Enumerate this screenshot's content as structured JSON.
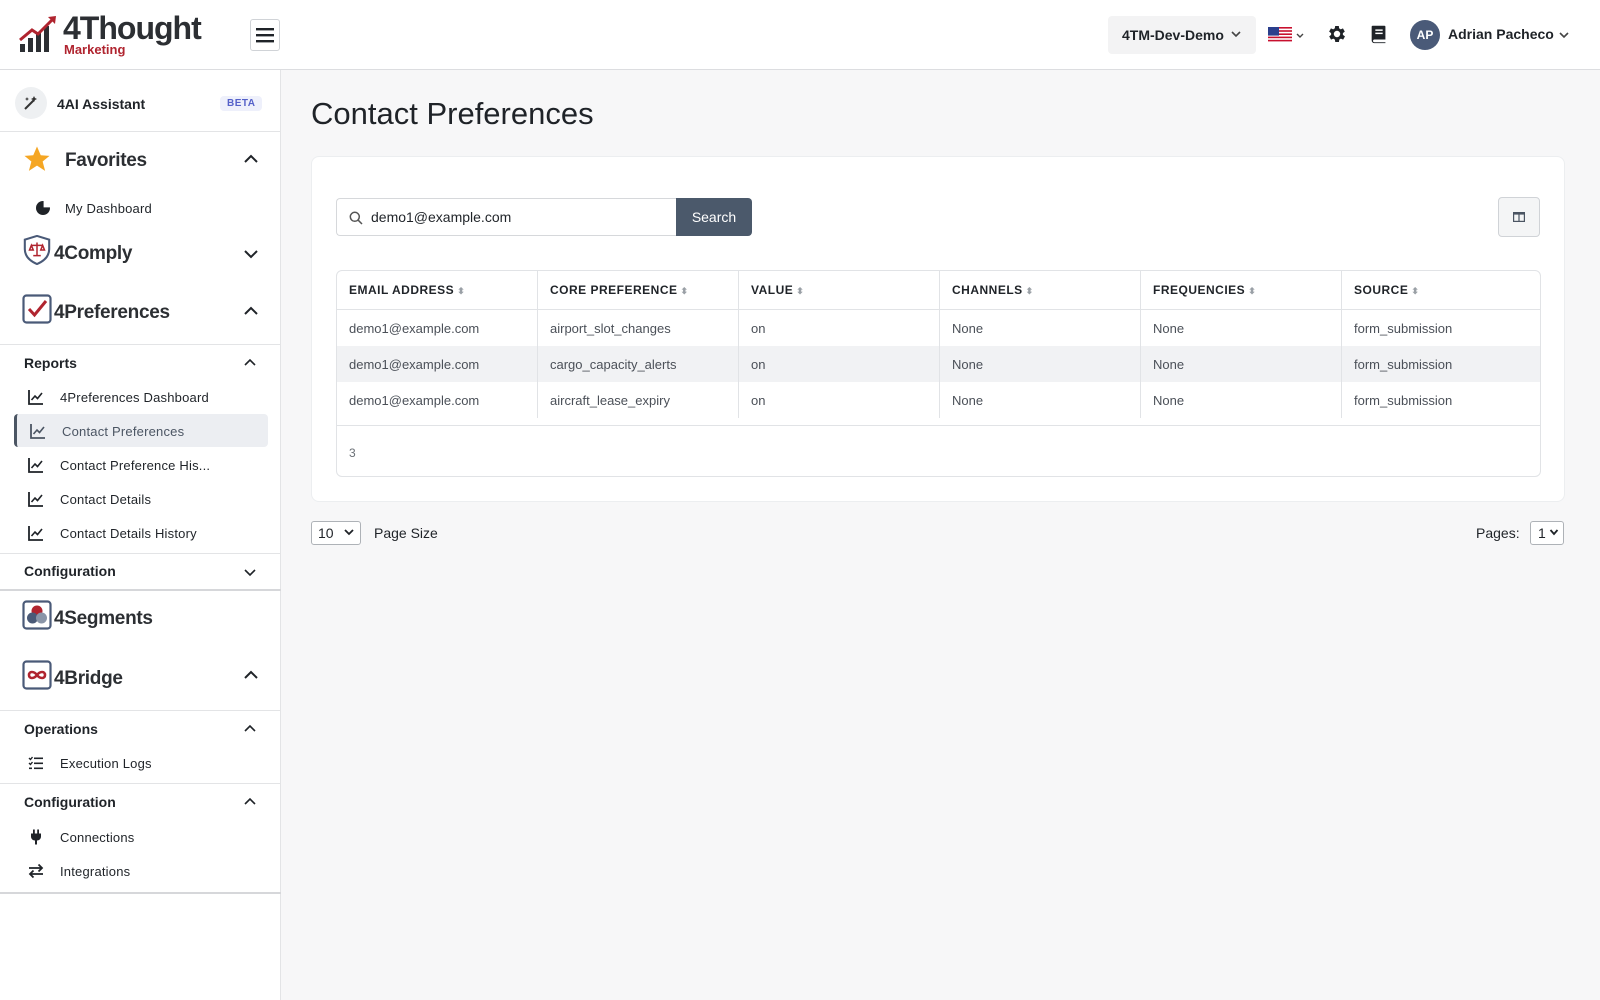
{
  "header": {
    "logo_title": "4Thought",
    "logo_sub": "Marketing",
    "environment": "4TM-Dev-Demo",
    "user_initials": "AP",
    "user_name": "Adrian Pacheco"
  },
  "sidebar": {
    "ai_label": "4AI Assistant",
    "ai_badge": "BETA",
    "favorites": {
      "title": "Favorites",
      "items": [
        {
          "label": "My Dashboard"
        }
      ]
    },
    "comply": {
      "title": "4Comply"
    },
    "preferences": {
      "title": "4Preferences",
      "reports_title": "Reports",
      "reports": [
        {
          "label": "4Preferences Dashboard"
        },
        {
          "label": "Contact Preferences"
        },
        {
          "label": "Contact Preference His..."
        },
        {
          "label": "Contact Details"
        },
        {
          "label": "Contact Details History"
        }
      ],
      "config_title": "Configuration"
    },
    "segments": {
      "title": "4Segments"
    },
    "bridge": {
      "title": "4Bridge",
      "operations_title": "Operations",
      "operations": [
        {
          "label": "Execution Logs"
        }
      ],
      "config_title": "Configuration",
      "config": [
        {
          "label": "Connections"
        },
        {
          "label": "Integrations"
        }
      ]
    }
  },
  "main": {
    "page_title": "Contact Preferences",
    "search": {
      "value": "demo1@example.com",
      "button": "Search"
    },
    "table": {
      "columns": [
        "EMAIL ADDRESS",
        "CORE PREFERENCE",
        "VALUE",
        "CHANNELS",
        "FREQUENCIES",
        "SOURCE"
      ],
      "rows": [
        [
          "demo1@example.com",
          "airport_slot_changes",
          "on",
          "None",
          "None",
          "form_submission"
        ],
        [
          "demo1@example.com",
          "cargo_capacity_alerts",
          "on",
          "None",
          "None",
          "form_submission"
        ],
        [
          "demo1@example.com",
          "aircraft_lease_expiry",
          "on",
          "None",
          "None",
          "form_submission"
        ]
      ],
      "count": "3"
    },
    "pagination": {
      "page_size": "10",
      "page_size_label": "Page Size",
      "pages_label": "Pages:",
      "page": "1"
    }
  },
  "colors": {
    "brand_red": "#b0242f",
    "button": "#4b596b",
    "star": "#f5a623"
  }
}
